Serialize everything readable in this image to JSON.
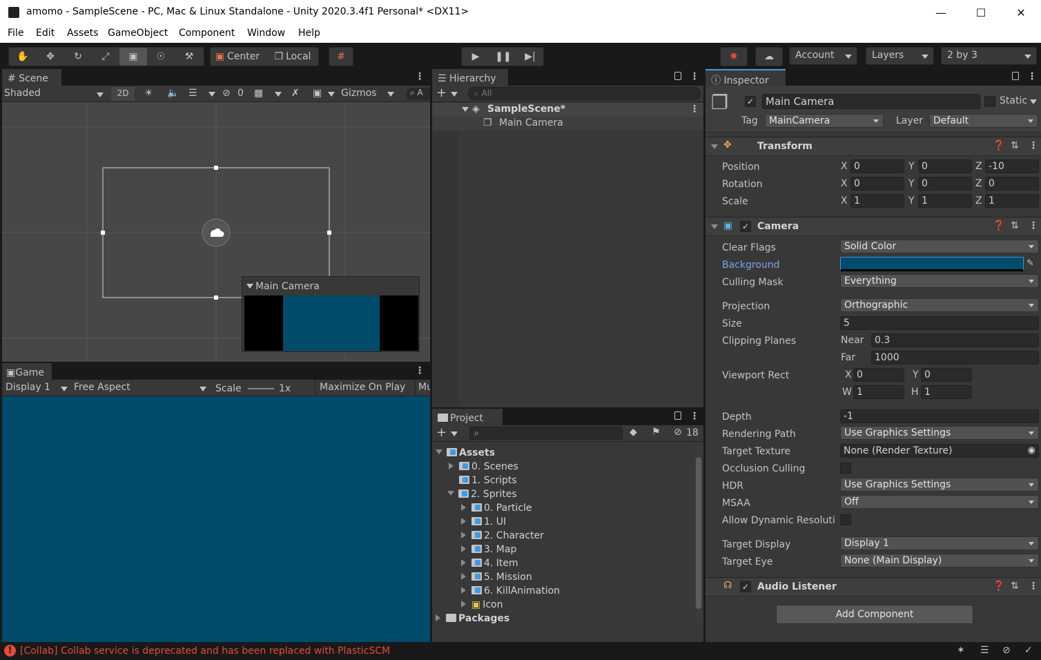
{
  "window": {
    "title": "amomo - SampleScene - PC, Mac & Linux Standalone - Unity 2020.3.4f1 Personal* <DX11>"
  },
  "menu": [
    "File",
    "Edit",
    "Assets",
    "GameObject",
    "Component",
    "Window",
    "Help"
  ],
  "toolbar": {
    "center": "Center",
    "local": "Local",
    "account": "Account",
    "layers": "Layers",
    "layout": "2 by 3"
  },
  "scene": {
    "tab": "Scene",
    "shading": "Shaded",
    "mode2d": "2D",
    "hidden_count": "0",
    "gizmos": "Gizmos",
    "search_glyph": "A",
    "camera_preview_title": "Main Camera"
  },
  "game": {
    "tab": "Game",
    "display": "Display 1",
    "aspect": "Free Aspect",
    "scale_label": "Scale",
    "scale_value": "1x",
    "maximize": "Maximize On Play",
    "more": "Mu",
    "bg_color": "#014B6B"
  },
  "hierarchy": {
    "tab": "Hierarchy",
    "search_placeholder": "All",
    "scene": "SampleScene*",
    "items": [
      "Main Camera"
    ]
  },
  "project": {
    "tab": "Project",
    "hidden_count": "18",
    "tree": [
      {
        "label": "Assets",
        "bold": true
      },
      {
        "label": "0. Scenes"
      },
      {
        "label": "1. Scripts"
      },
      {
        "label": "2. Sprites"
      },
      {
        "label": "0. Particle"
      },
      {
        "label": "1. UI"
      },
      {
        "label": "2. Character"
      },
      {
        "label": "3. Map"
      },
      {
        "label": "4. Item"
      },
      {
        "label": "5. Mission"
      },
      {
        "label": "6. KillAnimation"
      },
      {
        "label": "Icon"
      },
      {
        "label": "Packages",
        "bold": true
      }
    ]
  },
  "inspector": {
    "tab": "Inspector",
    "object_name": "Main Camera",
    "static_label": "Static",
    "tag_label": "Tag",
    "tag": "MainCamera",
    "layer_label": "Layer",
    "layer": "Default",
    "transform": {
      "title": "Transform",
      "position_label": "Position",
      "position": {
        "x": "0",
        "y": "0",
        "z": "-10"
      },
      "rotation_label": "Rotation",
      "rotation": {
        "x": "0",
        "y": "0",
        "z": "0"
      },
      "scale_label": "Scale",
      "scale": {
        "x": "1",
        "y": "1",
        "z": "1"
      }
    },
    "camera": {
      "title": "Camera",
      "clear_flags_label": "Clear Flags",
      "clear_flags": "Solid Color",
      "background_label": "Background",
      "background_color": "#014B6B",
      "culling_mask_label": "Culling Mask",
      "culling_mask": "Everything",
      "projection_label": "Projection",
      "projection": "Orthographic",
      "size_label": "Size",
      "size": "5",
      "clipping_label": "Clipping Planes",
      "near_label": "Near",
      "near": "0.3",
      "far_label": "Far",
      "far": "1000",
      "viewport_label": "Viewport Rect",
      "vx": "0",
      "vy": "0",
      "vw": "1",
      "vh": "1",
      "depth_label": "Depth",
      "depth": "-1",
      "rendering_path_label": "Rendering Path",
      "rendering_path": "Use Graphics Settings",
      "target_texture_label": "Target Texture",
      "target_texture": "None (Render Texture)",
      "occlusion_label": "Occlusion Culling",
      "hdr_label": "HDR",
      "hdr": "Use Graphics Settings",
      "msaa_label": "MSAA",
      "msaa": "Off",
      "dynres_label": "Allow Dynamic Resoluti",
      "target_display_label": "Target Display",
      "target_display": "Display 1",
      "target_eye_label": "Target Eye",
      "target_eye": "None (Main Display)"
    },
    "audio_listener": {
      "title": "Audio Listener"
    },
    "add_component": "Add Component"
  },
  "status": {
    "message": "[Collab] Collab service is deprecated and has been replaced with PlasticSCM"
  },
  "colors": {
    "accent_link": "#7ba4e8",
    "error": "#e34b3a"
  }
}
